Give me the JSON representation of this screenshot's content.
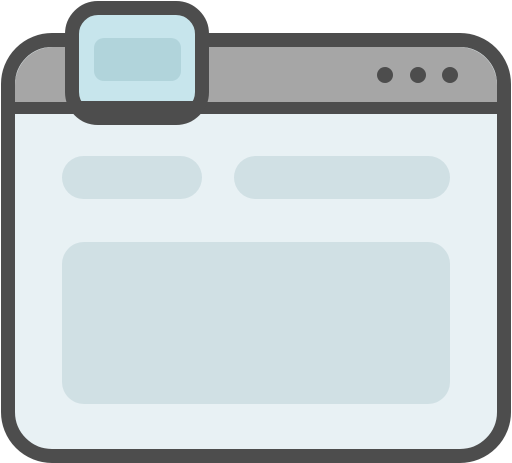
{
  "icon": {
    "name": "browser-window-icon",
    "colors": {
      "outline": "#4d4d4d",
      "titlebar": "#a6a6a6",
      "window_body": "#e8f1f4",
      "tab": "#c7e5ec",
      "tab_inner": "#b1d4db",
      "placeholder": "#d0e0e4",
      "dots": "#4d4d4d"
    }
  }
}
